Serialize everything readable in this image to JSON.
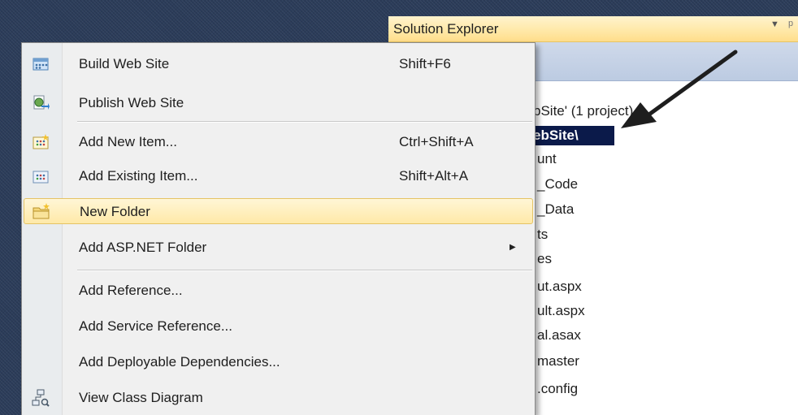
{
  "solution_explorer": {
    "title": "Solution Explorer",
    "dropdown_glyph": "▼",
    "pin_glyph": "ᵖ",
    "tree": {
      "solution_label": "bSite' (1 project)",
      "selected_label": "ebSite\\",
      "items": [
        "unt",
        "_Code",
        "_Data",
        "ts",
        "es",
        "ut.aspx",
        "ult.aspx",
        "al.asax",
        "master",
        ".config"
      ]
    }
  },
  "context_menu": {
    "items": [
      {
        "label": "Build Web Site",
        "shortcut": "Shift+F6",
        "icon": "build-web-site-icon"
      },
      {
        "label": "Publish Web Site",
        "shortcut": "",
        "icon": "publish-web-site-icon"
      },
      {
        "label": "Add New Item...",
        "shortcut": "Ctrl+Shift+A",
        "icon": "add-new-item-icon"
      },
      {
        "label": "Add Existing Item...",
        "shortcut": "Shift+Alt+A",
        "icon": "add-existing-item-icon"
      },
      {
        "label": "New Folder",
        "shortcut": "",
        "icon": "new-folder-icon",
        "highlighted": true
      },
      {
        "label": "Add ASP.NET Folder",
        "shortcut": "",
        "has_submenu": true
      },
      {
        "label": "Add Reference...",
        "shortcut": ""
      },
      {
        "label": "Add Service Reference...",
        "shortcut": ""
      },
      {
        "label": "Add Deployable Dependencies...",
        "shortcut": ""
      },
      {
        "label": "View Class Diagram",
        "shortcut": "",
        "icon": "class-diagram-icon"
      }
    ],
    "submenu_glyph": "▶"
  },
  "colors": {
    "menu_highlight": "#ffe9a8",
    "titlebar": "#ffe8a6",
    "selection": "#0b1a4a",
    "background": "#2b3c59"
  }
}
